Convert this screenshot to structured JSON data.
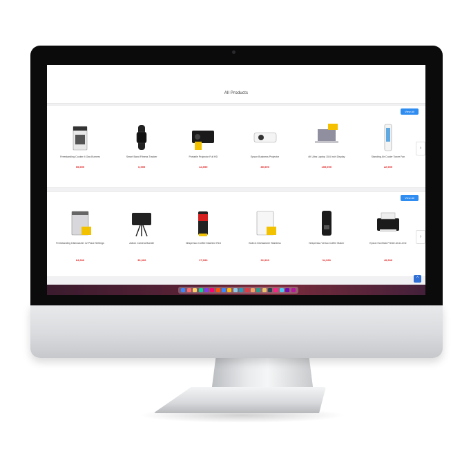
{
  "page": {
    "title": "All Products"
  },
  "section1": {
    "view_all_label": "View All",
    "next_arrow": "›",
    "products": [
      {
        "name": "Freestanding Cooker 4 Gas Burners",
        "price": "55,999",
        "icon": "cooker-icon"
      },
      {
        "name": "Smart Band Fitness Tracker",
        "price": "6,999",
        "icon": "smartwatch-icon"
      },
      {
        "name": "Portable Projector Full HD",
        "price": "44,999",
        "icon": "projector-icon"
      },
      {
        "name": "Epson Business Projector",
        "price": "89,999",
        "icon": "projector-white-icon"
      },
      {
        "name": "4K Ultra Laptop 15.6 inch Display",
        "price": "159,999",
        "icon": "laptop-icon"
      },
      {
        "name": "Standing Air Cooler Tower Fan",
        "price": "22,999",
        "icon": "air-cooler-icon"
      }
    ]
  },
  "section2": {
    "view_all_label": "View All",
    "next_arrow": "›",
    "products": [
      {
        "name": "Freestanding Dishwasher 12 Place Settings",
        "price": "84,999",
        "icon": "dishwasher-icon"
      },
      {
        "name": "Action Camera Bundle",
        "price": "39,999",
        "icon": "camera-icon"
      },
      {
        "name": "Nespresso Coffee Machine Red",
        "price": "27,999",
        "icon": "coffee-machine-red-icon"
      },
      {
        "name": "Built-in Dishwasher Stainless",
        "price": "92,999",
        "icon": "dishwasher-white-icon"
      },
      {
        "name": "Nespresso Vertuo Coffee Maker",
        "price": "34,999",
        "icon": "coffee-machine-black-icon"
      },
      {
        "name": "Epson EcoTank Printer All-in-One",
        "price": "49,999",
        "icon": "printer-icon"
      }
    ]
  },
  "scroll_top_label": "^",
  "dock_colors": [
    "#3a86ff",
    "#ff6b6b",
    "#ffd166",
    "#06d6a0",
    "#8338ec",
    "#ff006e",
    "#fb5607",
    "#3a86ff",
    "#ffbe0b",
    "#8ecae6",
    "#219ebc",
    "#e63946",
    "#f4a261",
    "#2a9d8f",
    "#e9c46a",
    "#264653",
    "#f72585",
    "#4cc9f0",
    "#7209b7",
    "#b5179e"
  ]
}
